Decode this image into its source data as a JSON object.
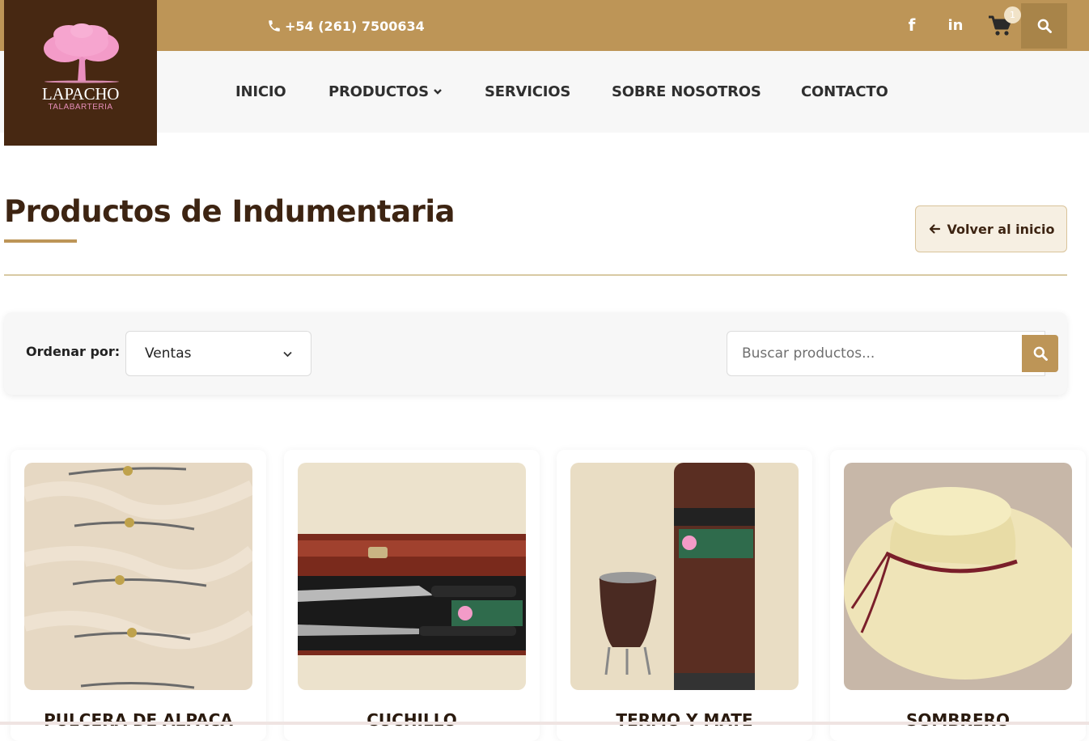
{
  "header": {
    "phone": "+54 (261) 7500634",
    "cart_count": "1",
    "social": {
      "facebook": "f",
      "linkedin": "in"
    }
  },
  "logo": {
    "name": "LAPACHO",
    "subtitle": "TALABARTERIA"
  },
  "nav": {
    "items": [
      {
        "label": "INICIO"
      },
      {
        "label": "PRODUCTOS"
      },
      {
        "label": "SERVICIOS"
      },
      {
        "label": "SOBRE NOSOTROS"
      },
      {
        "label": "CONTACTO"
      }
    ]
  },
  "page": {
    "title": "Productos de Indumentaria",
    "back_label": "Volver al inicio"
  },
  "filters": {
    "order_label": "Ordenar por:",
    "order_value": "Ventas",
    "search_placeholder": "Buscar productos..."
  },
  "products": [
    {
      "name": "PULCERA DE ALPACA"
    },
    {
      "name": "CUCHILLO"
    },
    {
      "name": "TERMO Y MATE"
    },
    {
      "name": "SOMBRERO"
    }
  ],
  "icons": {
    "phone": "phone-icon",
    "cart": "cart-icon",
    "search": "search-icon",
    "back": "arrow-left-icon",
    "select": "chevron-down-icon"
  },
  "colors": {
    "topbar": "#bd9557",
    "logo_bg": "#472812",
    "accent": "#bd9557",
    "title": "#3d2412"
  }
}
